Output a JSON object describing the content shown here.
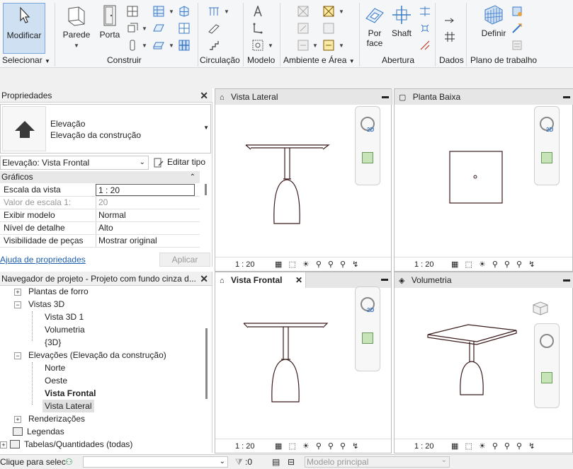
{
  "ribbon": {
    "modify_label": "Modificar",
    "select_label": "Selecionar",
    "groups": {
      "construir": "Construir",
      "circulacao": "Circulação",
      "modelo": "Modelo",
      "ambiente": "Ambiente e Área",
      "abertura": "Abertura",
      "dados": "Dados",
      "plano": "Plano de trabalho"
    },
    "buttons": {
      "parede": "Parede",
      "porta": "Porta",
      "por_face_1": "Por",
      "por_face_2": "face",
      "shaft": "Shaft",
      "definir": "Definir"
    }
  },
  "properties": {
    "title": "Propriedades",
    "type_line1": "Elevação",
    "type_line2": "Elevação da construção",
    "selector_value": "Elevação: Vista Frontal",
    "edit_type": "Editar tipo",
    "section": "Gráficos",
    "rows": [
      {
        "key": "Escala da vista",
        "value": "1 : 20"
      },
      {
        "key": "Valor de escala    1:",
        "value": "20"
      },
      {
        "key": "Exibir modelo",
        "value": "Normal"
      },
      {
        "key": "Nível de detalhe",
        "value": "Alto"
      },
      {
        "key": "Visibilidade de peças",
        "value": "Mostrar original"
      }
    ],
    "help_link": "Ajuda de propriedades",
    "apply_label": "Aplicar"
  },
  "browser": {
    "title": "Navegador de projeto - Projeto com fundo cinza d...",
    "items": [
      {
        "label": "Plantas de forro"
      },
      {
        "label": "Vistas 3D"
      },
      {
        "label": "Vista 3D 1"
      },
      {
        "label": "Volumetria"
      },
      {
        "label": "{3D}"
      },
      {
        "label": "Elevações (Elevação da construção)"
      },
      {
        "label": "Norte"
      },
      {
        "label": "Oeste"
      },
      {
        "label": "Vista Frontal"
      },
      {
        "label": "Vista Lateral"
      },
      {
        "label": "Renderizações"
      },
      {
        "label": "Legendas"
      },
      {
        "label": "Tabelas/Quantidades (todas)"
      }
    ]
  },
  "views": {
    "lateral": {
      "title": "Vista Lateral",
      "scale": "1 : 20"
    },
    "planta": {
      "title": "Planta Baixa",
      "scale": "1 : 20"
    },
    "frontal": {
      "title": "Vista Frontal",
      "scale": "1 : 20"
    },
    "volumetria": {
      "title": "Volumetria",
      "scale": "1 : 20"
    },
    "nav_2d": "2D"
  },
  "status": {
    "prompt": "Clique para selec",
    "filter_count": ":0",
    "model": "Modelo principal"
  },
  "colors": {
    "accent": "#3a78c6",
    "linework": "#3b1a1a",
    "ribbon_bg": "#f5f6f7"
  }
}
